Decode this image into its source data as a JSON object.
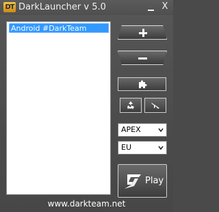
{
  "window": {
    "icon_text": "DT",
    "title": "DarkLauncher v 5.0",
    "minimize_label": "",
    "close_label": "X"
  },
  "profiles": {
    "items": [
      "Android #DarkTeam"
    ],
    "selected_index": 0
  },
  "controls": {
    "add_icon": "plus-icon",
    "remove_icon": "minus-icon",
    "plugin_icon": "puzzle-icon",
    "recycle_icon": "recycle-icon",
    "plane_icon": "plane-icon",
    "region_select": {
      "value": "APEX"
    },
    "server_select": {
      "value": "EU"
    },
    "play_label": "Play"
  },
  "footer": {
    "text": "www.darkteam.net"
  },
  "colors": {
    "background": "#4a4a4a",
    "selection": "#3399ff",
    "button_dark": "#4a4a4a",
    "text_light": "#ffffff"
  }
}
